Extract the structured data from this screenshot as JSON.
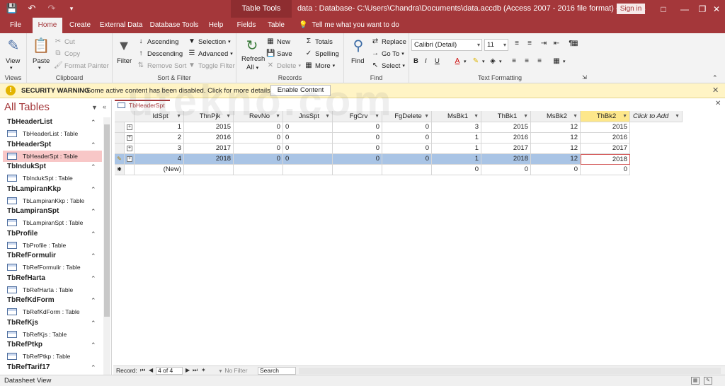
{
  "titlebar": {
    "context_tab": "Table Tools",
    "title": "data : Database- C:\\Users\\Chandra\\Documents\\data.accdb (Access 2007 - 2016 file format)  -  Access",
    "signin_label": "Sign in"
  },
  "tabs": [
    "File",
    "Home",
    "Create",
    "External Data",
    "Database Tools",
    "Help",
    "Fields",
    "Table"
  ],
  "tell_me": "Tell me what you want to do",
  "ribbon": {
    "views": {
      "view_label": "View",
      "group": "Views"
    },
    "clipboard": {
      "paste": "Paste",
      "cut": "Cut",
      "copy": "Copy",
      "format_painter": "Format Painter",
      "group": "Clipboard"
    },
    "sort_filter": {
      "filter": "Filter",
      "ascending": "Ascending",
      "descending": "Descending",
      "remove_sort": "Remove Sort",
      "selection": "Selection",
      "advanced": "Advanced",
      "toggle_filter": "Toggle Filter",
      "group": "Sort & Filter"
    },
    "records": {
      "refresh": "Refresh",
      "refresh2": "All",
      "new": "New",
      "save": "Save",
      "delete": "Delete",
      "totals": "Totals",
      "spelling": "Spelling",
      "more": "More",
      "group": "Records"
    },
    "find": {
      "find": "Find",
      "replace": "Replace",
      "goto": "Go To",
      "select": "Select",
      "group": "Find"
    },
    "text_formatting": {
      "font": "Calibri (Detail)",
      "size": "11",
      "group": "Text Formatting"
    }
  },
  "security": {
    "title": "SECURITY WARNING",
    "message": "Some active content has been disabled. Click for more details.",
    "button": "Enable Content"
  },
  "nav": {
    "header": "All Tables",
    "groups": [
      {
        "name": "TbHeaderList",
        "item": "TbHeaderList : Table"
      },
      {
        "name": "TbHeaderSpt",
        "item": "TbHeaderSpt : Table",
        "selected": true
      },
      {
        "name": "TbIndukSpt",
        "item": "TbIndukSpt : Table"
      },
      {
        "name": "TbLampiranKkp",
        "item": "TbLampiranKkp : Table"
      },
      {
        "name": "TbLampiranSpt",
        "item": "TbLampiranSpt : Table"
      },
      {
        "name": "TbProfile",
        "item": "TbProfile : Table"
      },
      {
        "name": "TbRefFormulir",
        "item": "TbRefFormulir : Table"
      },
      {
        "name": "TbRefHarta",
        "item": "TbRefHarta : Table"
      },
      {
        "name": "TbRefKdForm",
        "item": "TbRefKdForm : Table"
      },
      {
        "name": "TbRefKjs",
        "item": "TbRefKjs : Table"
      },
      {
        "name": "TbRefPtkp",
        "item": "TbRefPtkp : Table"
      },
      {
        "name": "TbRefTarif17",
        "item": ""
      }
    ]
  },
  "doc_tab": "TbHeaderSpt",
  "grid": {
    "columns": [
      "IdSpt",
      "ThnPjk",
      "RevNo",
      "JnsSpt",
      "FgCrv",
      "FgDelete",
      "MsBk1",
      "ThBk1",
      "MsBk2",
      "ThBk2",
      "Click to Add"
    ],
    "rows": [
      [
        "1",
        "2015",
        "0",
        "0",
        "0",
        "0",
        "3",
        "2015",
        "12",
        "2015"
      ],
      [
        "2",
        "2016",
        "0",
        "0",
        "0",
        "0",
        "1",
        "2016",
        "12",
        "2016"
      ],
      [
        "3",
        "2017",
        "0",
        "0",
        "0",
        "0",
        "1",
        "2017",
        "12",
        "2017"
      ],
      [
        "4",
        "2018",
        "0",
        "0",
        "0",
        "0",
        "1",
        "2018",
        "12",
        "2018"
      ]
    ],
    "new_row": [
      "(New)",
      "",
      "",
      "",
      "",
      "",
      "0",
      "0",
      "0",
      "0"
    ]
  },
  "recordnav": {
    "label": "Record:",
    "position": "4 of 4",
    "no_filter": "No Filter",
    "search": "Search"
  },
  "status": {
    "text": "Datasheet View"
  },
  "watermark": "utekno.com"
}
